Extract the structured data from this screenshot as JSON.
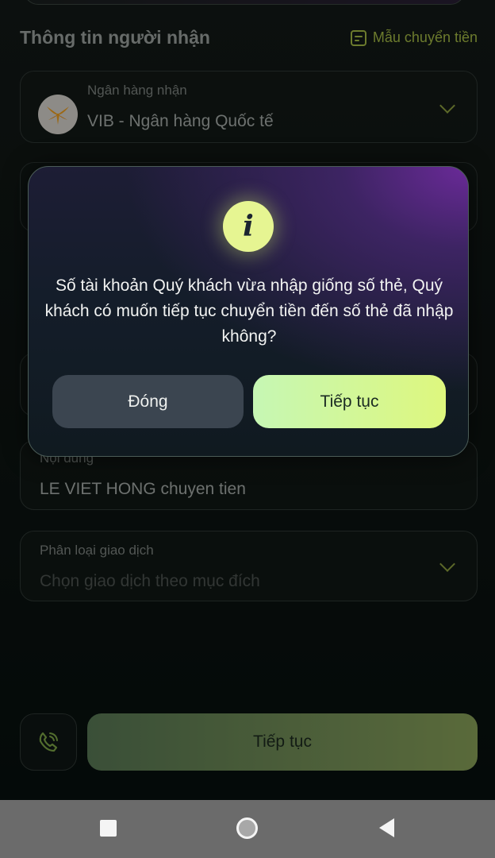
{
  "recipient_section": {
    "title": "Thông tin người nhận",
    "template_link": "Mẫu chuyển tiền"
  },
  "bank_field": {
    "label": "Ngân hàng nhận",
    "value": "VIB - Ngân hàng Quốc tế"
  },
  "content_field": {
    "label": "Nội dung",
    "value": "LE VIET HONG chuyen tien"
  },
  "transaction_type_field": {
    "label": "Phân loại giao dịch",
    "placeholder": "Chọn giao dịch theo mục đích"
  },
  "dialog": {
    "icon": "info-icon",
    "message": "Số tài khoản Quý khách vừa nhập giống số thẻ, Quý khách có muốn tiếp tục chuyển tiền đến số thẻ đã nhập không?",
    "close_label": "Đóng",
    "continue_label": "Tiếp tục"
  },
  "bottom_bar": {
    "continue_label": "Tiếp tục"
  },
  "colors": {
    "accent": "#a7bd46",
    "dialog_button_primary": "#def77e",
    "dialog_button_secondary": "#3b4550"
  }
}
